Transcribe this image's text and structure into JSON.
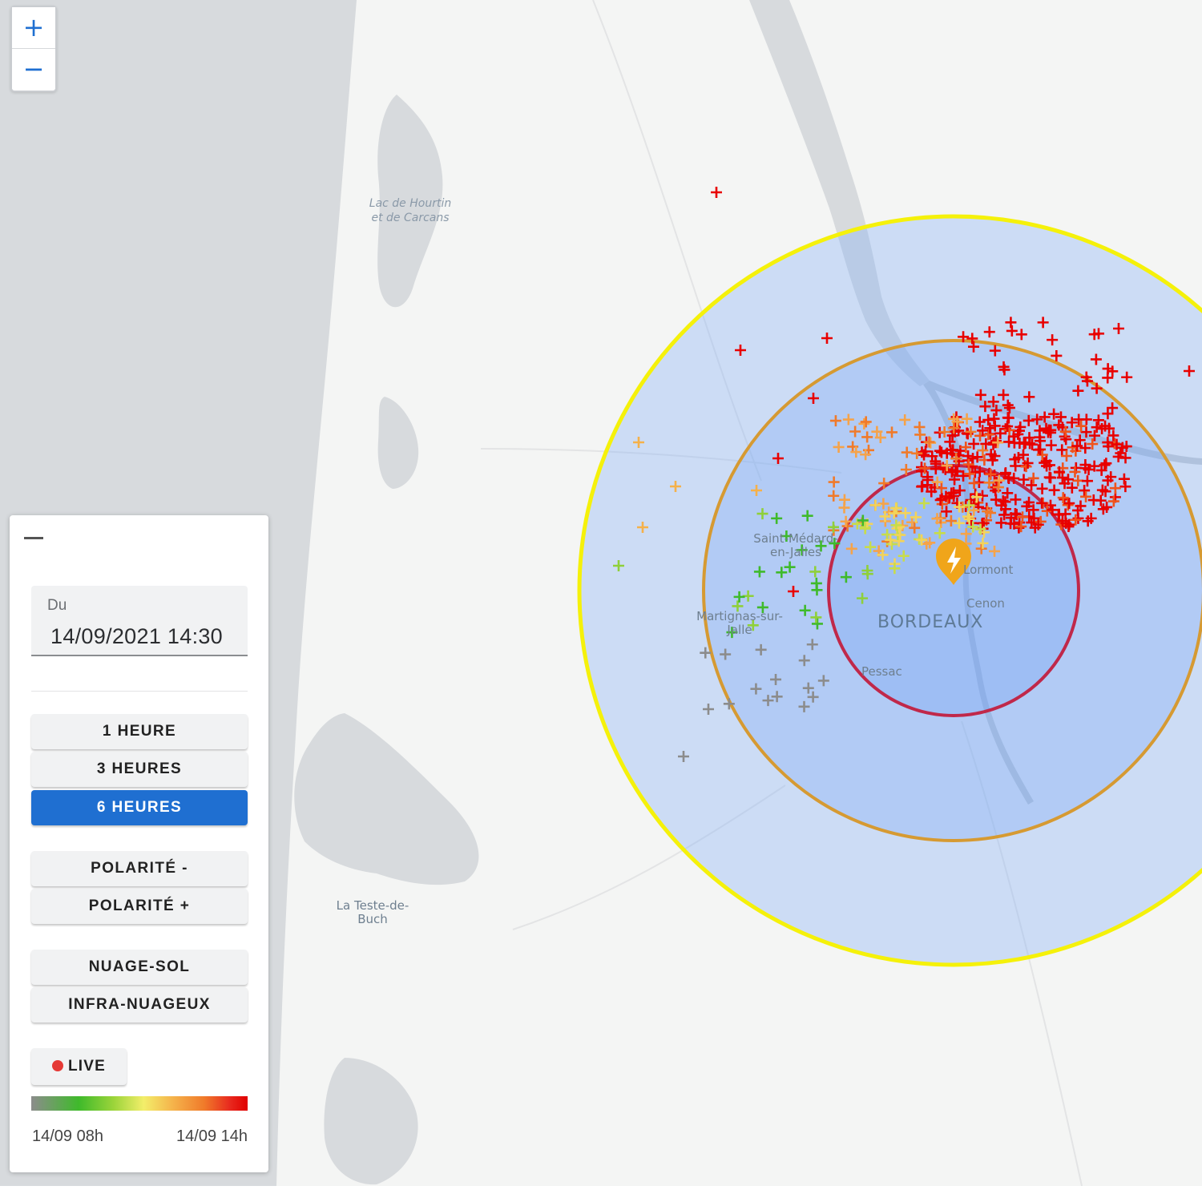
{
  "zoom": {
    "in_label": "+",
    "out_label": "−"
  },
  "map_labels": {
    "lake_line1": "Lac de Hourtin",
    "lake_line2": "et de Carcans",
    "saint_medard_line1": "Saint-Médard-",
    "saint_medard_line2": "en-Jalles",
    "martignas_line1": "Martignas-sur-",
    "martignas_line2": "Jalle",
    "bordeaux": "BORDEAUX",
    "lormont": "Lormont",
    "cenon": "Cenon",
    "pessac": "Pessac",
    "la_teste_line1": "La Teste-de-",
    "la_teste_line2": "Buch"
  },
  "panel": {
    "date": {
      "label": "Du",
      "value": "14/09/2021 14:30"
    },
    "time_options": [
      {
        "label": "1 HEURE",
        "active": false
      },
      {
        "label": "3 HEURES",
        "active": false
      },
      {
        "label": "6 HEURES",
        "active": true
      }
    ],
    "polarity_options": [
      {
        "label": "POLARITÉ -"
      },
      {
        "label": "POLARITÉ +"
      }
    ],
    "type_options": [
      {
        "label": "NUAGE-SOL"
      },
      {
        "label": "INFRA-NUAGEUX"
      }
    ],
    "live_label": "LIVE",
    "legend": {
      "start_label": "14/09 08h",
      "end_label": "14/09 14h",
      "colors": [
        "#8c8c8c",
        "#3fba2b",
        "#9bd43a",
        "#f3ee6a",
        "#f5b14a",
        "#f07a2a",
        "#e8281e",
        "#e00000"
      ]
    }
  },
  "colors": {
    "outer_ring": "#f5f10a",
    "middle_ring": "#d69a32",
    "inner_ring": "#c0284a",
    "marker": "#f0a51a",
    "accent": "#1f6fd1",
    "water": "#d7dadd"
  },
  "icons": {
    "marker": "lightning-marker-icon"
  }
}
